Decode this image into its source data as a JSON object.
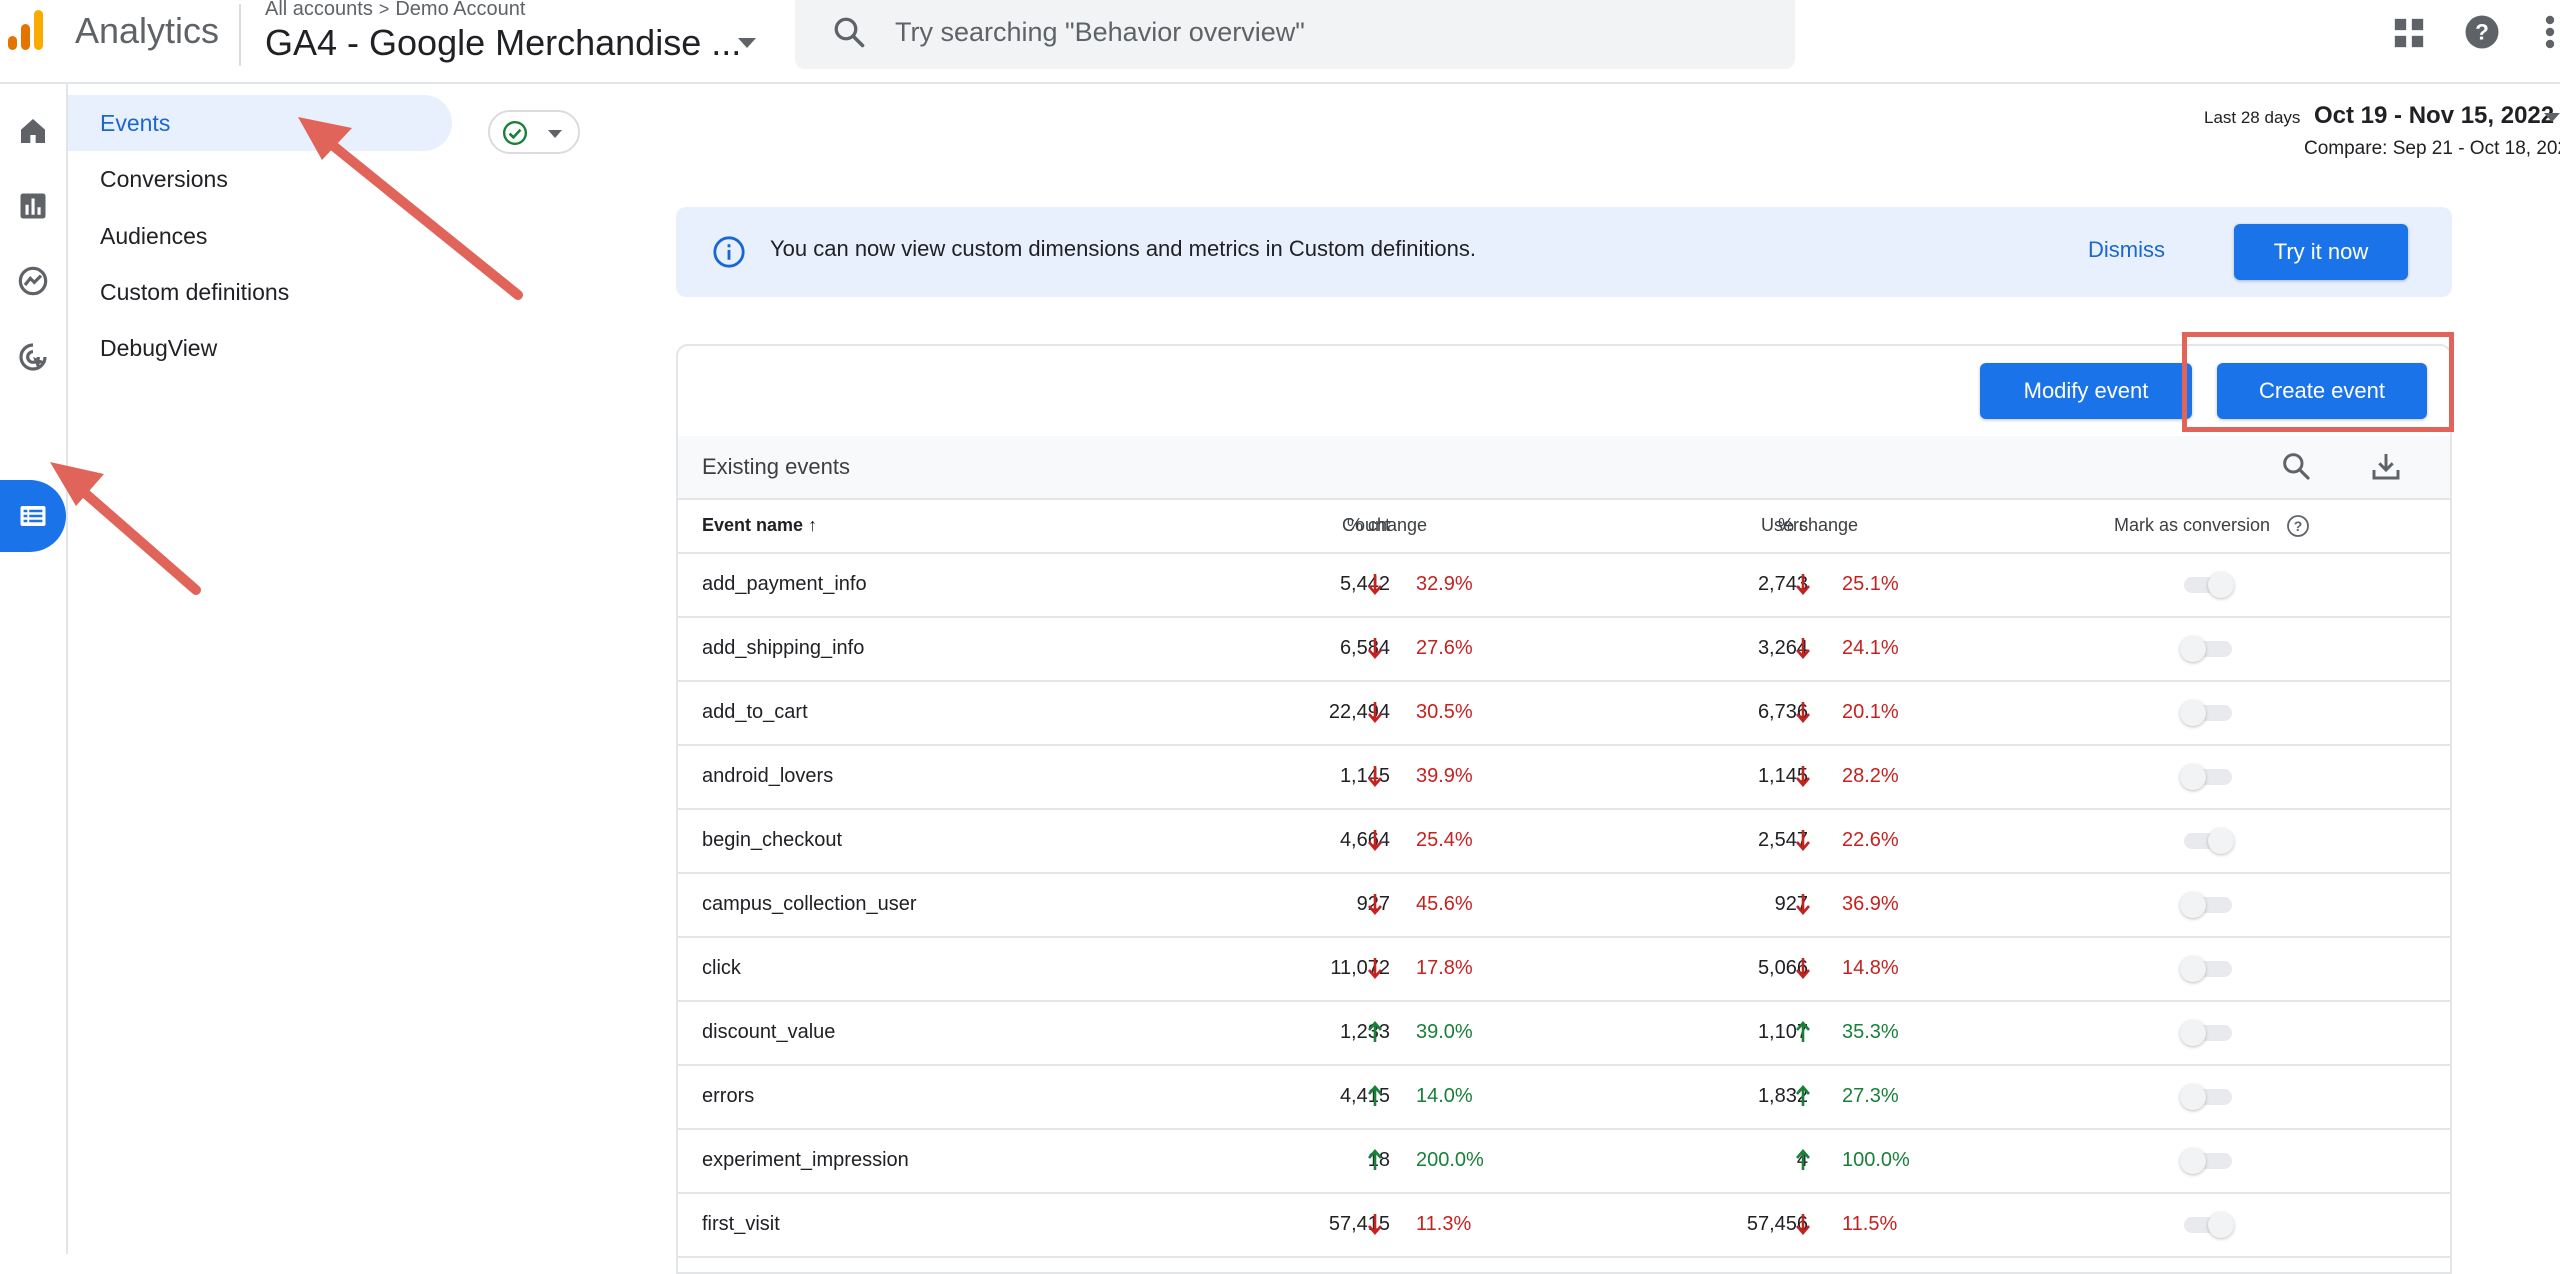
{
  "header": {
    "app_title": "Analytics",
    "breadcrumb_all_accounts": "All accounts",
    "breadcrumb_account": "Demo Account",
    "property_name": "GA4 - Google Merchandise ...",
    "search_placeholder": "Try searching \"Behavior overview\""
  },
  "rail": {
    "items": [
      "home",
      "reports",
      "explore",
      "advertising",
      "configure"
    ],
    "active": "configure"
  },
  "subnav": {
    "items": [
      {
        "label": "Events"
      },
      {
        "label": "Conversions"
      },
      {
        "label": "Audiences"
      },
      {
        "label": "Custom definitions"
      },
      {
        "label": "DebugView"
      }
    ],
    "active": "Events"
  },
  "date_range": {
    "preset": "Last 28 days",
    "range": "Oct 19 - Nov 15, 2022",
    "compare": "Compare: Sep 21 - Oct 18, 2022"
  },
  "banner": {
    "text": "You can now view custom dimensions and metrics in Custom definitions.",
    "dismiss": "Dismiss",
    "try_now": "Try it now"
  },
  "actions": {
    "modify_event": "Modify event",
    "create_event": "Create event"
  },
  "table": {
    "title": "Existing events",
    "headers": {
      "event_name": "Event name",
      "count": "Count",
      "count_change": "% change",
      "users": "Users",
      "users_change": "% change",
      "mark_conversion": "Mark as conversion"
    },
    "rows": [
      {
        "name": "add_payment_info",
        "count": "5,442",
        "count_change": "32.9%",
        "count_dir": "down",
        "users": "2,743",
        "users_change": "25.1%",
        "users_dir": "down",
        "conversion": true
      },
      {
        "name": "add_shipping_info",
        "count": "6,584",
        "count_change": "27.6%",
        "count_dir": "down",
        "users": "3,264",
        "users_change": "24.1%",
        "users_dir": "down",
        "conversion": false
      },
      {
        "name": "add_to_cart",
        "count": "22,494",
        "count_change": "30.5%",
        "count_dir": "down",
        "users": "6,736",
        "users_change": "20.1%",
        "users_dir": "down",
        "conversion": false
      },
      {
        "name": "android_lovers",
        "count": "1,145",
        "count_change": "39.9%",
        "count_dir": "down",
        "users": "1,145",
        "users_change": "28.2%",
        "users_dir": "down",
        "conversion": false
      },
      {
        "name": "begin_checkout",
        "count": "4,664",
        "count_change": "25.4%",
        "count_dir": "down",
        "users": "2,547",
        "users_change": "22.6%",
        "users_dir": "down",
        "conversion": true
      },
      {
        "name": "campus_collection_user",
        "count": "927",
        "count_change": "45.6%",
        "count_dir": "down",
        "users": "927",
        "users_change": "36.9%",
        "users_dir": "down",
        "conversion": false
      },
      {
        "name": "click",
        "count": "11,072",
        "count_change": "17.8%",
        "count_dir": "down",
        "users": "5,066",
        "users_change": "14.8%",
        "users_dir": "down",
        "conversion": false
      },
      {
        "name": "discount_value",
        "count": "1,233",
        "count_change": "39.0%",
        "count_dir": "up",
        "users": "1,107",
        "users_change": "35.3%",
        "users_dir": "up",
        "conversion": false
      },
      {
        "name": "errors",
        "count": "4,415",
        "count_change": "14.0%",
        "count_dir": "up",
        "users": "1,832",
        "users_change": "27.3%",
        "users_dir": "up",
        "conversion": false
      },
      {
        "name": "experiment_impression",
        "count": "18",
        "count_change": "200.0%",
        "count_dir": "up",
        "users": "4",
        "users_change": "100.0%",
        "users_dir": "up",
        "conversion": false
      },
      {
        "name": "first_visit",
        "count": "57,415",
        "count_change": "11.3%",
        "count_dir": "down",
        "users": "57,456",
        "users_change": "11.5%",
        "users_dir": "down",
        "conversion": true
      }
    ]
  },
  "colors": {
    "primary": "#1a73e8",
    "down": "#c5221f",
    "up": "#188038",
    "annotation": "#e0645a"
  }
}
